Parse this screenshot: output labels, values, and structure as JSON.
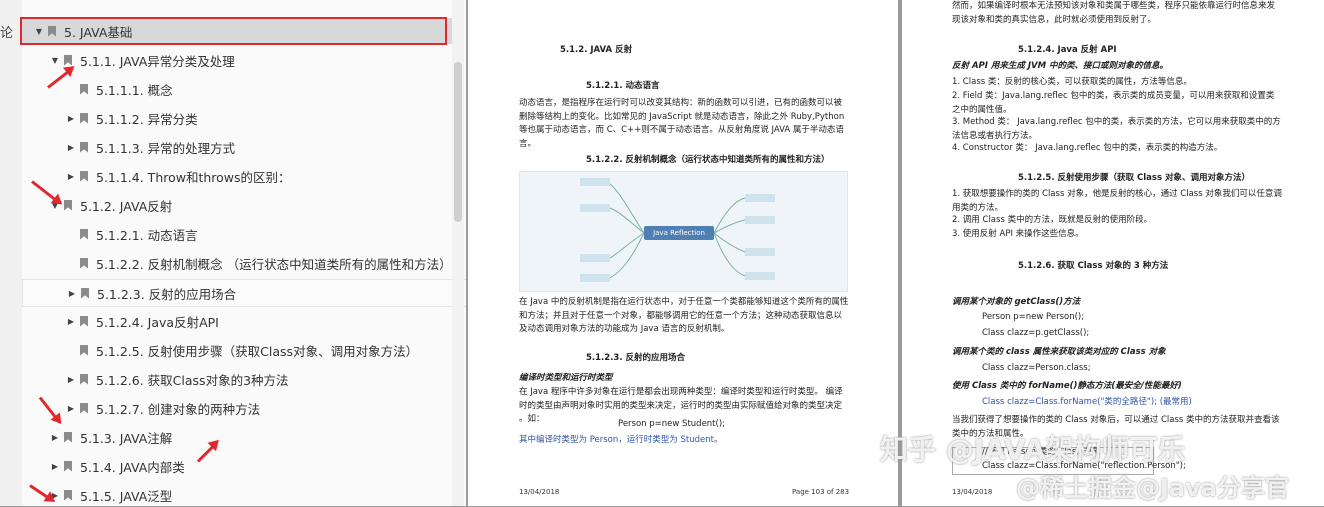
{
  "sidebar_strip": {
    "glyph": "论"
  },
  "outline": {
    "items": [
      {
        "label": "5. JAVA基础",
        "level": 0,
        "toggle": "▼",
        "selected": true
      },
      {
        "label": "5.1.1. JAVA异常分类及处理",
        "level": 1,
        "toggle": "▼"
      },
      {
        "label": "5.1.1.1. 概念",
        "level": 2,
        "toggle": ""
      },
      {
        "label": "5.1.1.2. 异常分类",
        "level": 2,
        "toggle": "▶"
      },
      {
        "label": "5.1.1.3. 异常的处理方式",
        "level": 2,
        "toggle": "▶"
      },
      {
        "label": "5.1.1.4. Throw和throws的区别：",
        "level": 2,
        "toggle": "▶"
      },
      {
        "label": "5.1.2. JAVA反射",
        "level": 1,
        "toggle": "▼"
      },
      {
        "label": "5.1.2.1. 动态语言",
        "level": 2,
        "toggle": ""
      },
      {
        "label": "5.1.2.2. 反射机制概念 （运行状态中知道类所有的属性和方法）",
        "level": 2,
        "toggle": ""
      },
      {
        "label": "5.1.2.3. 反射的应用场合",
        "level": 2,
        "toggle": "▶",
        "hover": true
      },
      {
        "label": "5.1.2.4. Java反射API",
        "level": 2,
        "toggle": "▶"
      },
      {
        "label": "5.1.2.5. 反射使用步骤（获取Class对象、调用对象方法）",
        "level": 2,
        "toggle": ""
      },
      {
        "label": "5.1.2.6. 获取Class对象的3种方法",
        "level": 2,
        "toggle": "▶"
      },
      {
        "label": "5.1.2.7. 创建对象的两种方法",
        "level": 2,
        "toggle": "▶"
      },
      {
        "label": "5.1.3. JAVA注解",
        "level": 1,
        "toggle": "▶"
      },
      {
        "label": "5.1.4. JAVA内部类",
        "level": 1,
        "toggle": "▶"
      },
      {
        "label": "5.1.5. JAVA泛型",
        "level": 1,
        "toggle": "▶"
      }
    ]
  },
  "page_left": {
    "h_512": "5.1.2.  JAVA 反射",
    "h_5121": "5.1.2.1.    动态语言",
    "p1": "动态语言，是指程序在运行时可以改变其结构：新的函数可以引进，已有的函数可以被删除等结构上的变化。比如常见的 JavaScript 就是动态语言，除此之外 Ruby,Python 等也属于动态语言，而 C、C++则不属于动态语言。从反射角度说 JAVA 属于半动态语言。",
    "h_5122": "5.1.2.2.    反射机制概念（运行状态中知道类所有的属性和方法）",
    "mindmap_center": "Java Reflection",
    "p2": "在 Java 中的反射机制是指在运行状态中，对于任意一个类都能够知道这个类所有的属性和方法；并且对于任意一个对象，都能够调用它的任意一个方法；这种动态获取信息以及动态调用对象方法的功能成为 Java 语言的反射机制。",
    "h_5123": "5.1.2.3.    反射的应用场合",
    "h_compile": "编译时类型和运行时类型",
    "p3": "在 Java 程序中许多对象在运行是都会出现两种类型：编译时类型和运行时类型。 编译时的类型由声明对象时实用的类型来决定，运行时的类型由实际赋值给对象的类型决定 。如：",
    "code1": "Person p=new Student();",
    "p4": "其中编译时类型为 Person，运行时类型为 Student。",
    "footer_date": "13/04/2018",
    "footer_page": "Page 103 of 283"
  },
  "page_right": {
    "p0": "然而，如果编译时根本无法预知该对象和类属于哪些类，程序只能依靠运行时信息来发现该对象和类的真实信息，此时就必须使用到反射了。",
    "h_5124": "5.1.2.4.    Java 反射 API",
    "h_api": "反射 API 用来生成 JVM 中的类、接口或则对象的信息。",
    "li1": "1.   Class 类：反射的核心类，可以获取类的属性，方法等信息。",
    "li2": "2.   Field 类：Java.lang.reflec 包中的类，表示类的成员变量，可以用来获取和设置类之中的属性值。",
    "li3": "3.   Method 类： Java.lang.reflec 包中的类，表示类的方法，它可以用来获取类中的方法信息或者执行方法。",
    "li4": "4.   Constructor 类： Java.lang.reflec 包中的类，表示类的构造方法。",
    "h_5125": "5.1.2.5.    反射使用步骤（获取 Class 对象、调用对象方法）",
    "s1": "1.   获取想要操作的类的 Class 对象，他是反射的核心，通过 Class 对象我们可以任意调用类的方法。",
    "s2": "2.   调用 Class 类中的方法，既就是反射的使用阶段。",
    "s3": "3.   使用反射 API 来操作这些信息。",
    "h_5126": "5.1.2.6.    获取 Class 对象的 3 种方法",
    "m1": "调用某个对象的 getClass()方法",
    "m1a": "Person p=new Person();",
    "m1b": "Class clazz=p.getClass();",
    "m2": "调用某个类的 class 属性来获取该类对应的 Class 对象",
    "m2a": "Class clazz=Person.class;",
    "m3": "使用 Class 类中的 forName()静态方法(最安全/性能最好)",
    "m3a": "Class clazz=Class.forName(\"类的全路径\"); (最常用)",
    "p5": "当我们获得了想要操作的类的 Class 对象后，可以通过 Class 类中的方法获取并查看该类中的方法和属性。",
    "code_a": "//获取 Person 类的 Class 对象",
    "code_b": "Class clazz=Class.forName(\"reflection.Person\");",
    "footer_date": "13/04/2018"
  },
  "watermark": {
    "line1": "知乎 @JAVA架构师可乐",
    "line2": "@稀土掘金@Java分享官"
  },
  "colors": {
    "highlight": "#e0282e",
    "link_blue": "#2f54a8",
    "node_blue": "#4f7fb3"
  }
}
